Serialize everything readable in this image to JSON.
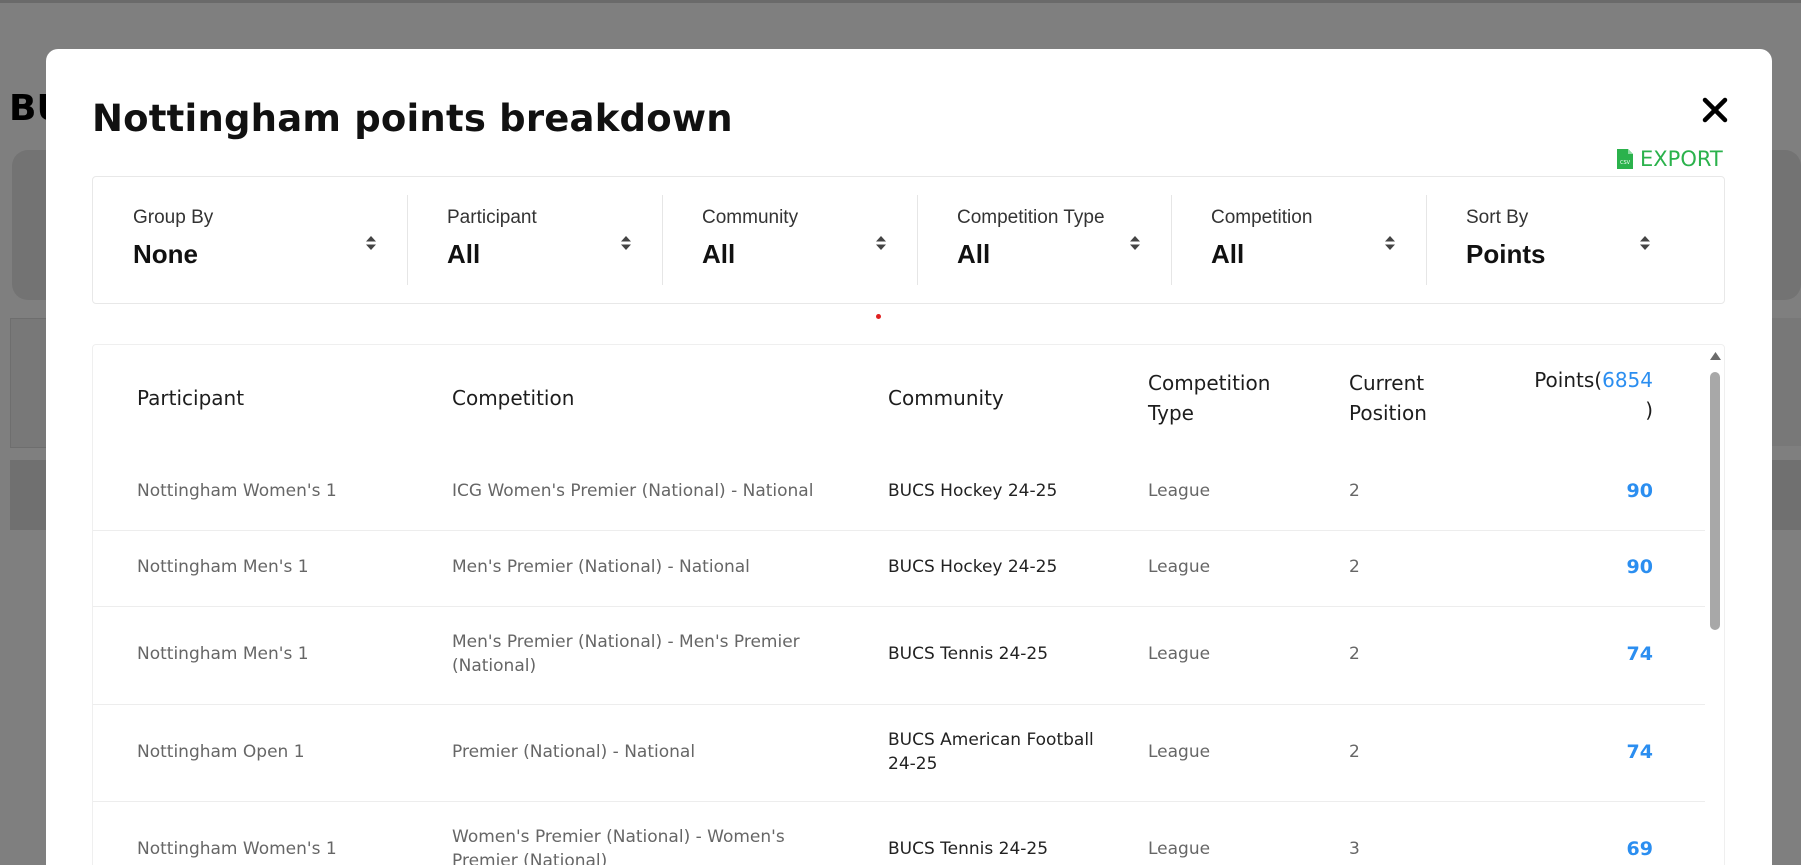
{
  "background": {
    "title_fragment": "BU"
  },
  "modal": {
    "title": "Nottingham points breakdown",
    "close_icon": "close-icon",
    "export": {
      "label": "EXPORT",
      "icon": "csv-file-icon",
      "color": "#2bb24c"
    }
  },
  "filters": [
    {
      "label": "Group By",
      "value": "None"
    },
    {
      "label": "Participant",
      "value": "All"
    },
    {
      "label": "Community",
      "value": "All"
    },
    {
      "label": "Competition Type",
      "value": "All"
    },
    {
      "label": "Competition",
      "value": "All"
    },
    {
      "label": "Sort By",
      "value": "Points"
    }
  ],
  "table": {
    "headers": {
      "participant": "Participant",
      "competition": "Competition",
      "community": "Community",
      "competition_type_line1": "Competition",
      "competition_type_line2": "Type",
      "current_position_line1": "Current",
      "current_position_line2": "Position",
      "points_prefix": "Points(",
      "points_total": "6854",
      "points_suffix": ")"
    },
    "rows": [
      {
        "participant": "Nottingham Women's 1",
        "competition": "ICG Women's Premier (National) - National",
        "community": "BUCS Hockey 24-25",
        "type": "League",
        "position": "2",
        "points": "90"
      },
      {
        "participant": "Nottingham Men's 1",
        "competition": "Men's Premier (National) - National",
        "community": "BUCS Hockey 24-25",
        "type": "League",
        "position": "2",
        "points": "90"
      },
      {
        "participant": "Nottingham Men's 1",
        "competition": "Men's Premier (National) - Men's Premier (National)",
        "community": "BUCS Tennis 24-25",
        "type": "League",
        "position": "2",
        "points": "74"
      },
      {
        "participant": "Nottingham Open 1",
        "competition": "Premier (National) - National",
        "community": "BUCS American Football 24-25",
        "type": "League",
        "position": "2",
        "points": "74"
      },
      {
        "participant": "Nottingham Women's 1",
        "competition": "Women's Premier (National) - Women's Premier (National)",
        "community": "BUCS Tennis 24-25",
        "type": "League",
        "position": "3",
        "points": "69"
      }
    ],
    "accent_color": "#2b8ef0"
  }
}
